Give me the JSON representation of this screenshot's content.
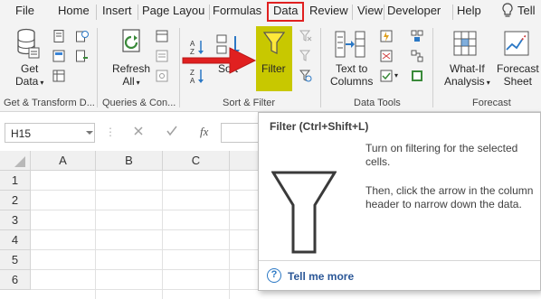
{
  "tabs": [
    "File",
    "Home",
    "Insert",
    "Page Layou",
    "Formulas",
    "Data",
    "Review",
    "View",
    "Developer",
    "Help",
    "Tell"
  ],
  "active_tab": "Data",
  "ribbon": {
    "get_data": {
      "line1": "Get",
      "line2": "Data"
    },
    "refresh_all": {
      "line1": "Refresh",
      "line2": "All"
    },
    "sort": "Sort",
    "filter": "Filter",
    "text_to_columns": {
      "line1": "Text to",
      "line2": "Columns"
    },
    "what_if": {
      "line1": "What-If",
      "line2": "Analysis"
    },
    "forecast_sheet": {
      "line1": "Forecast",
      "line2": "Sheet"
    },
    "groups": {
      "get_transform": "Get & Transform D...",
      "queries": "Queries & Con...",
      "sort_filter": "Sort & Filter",
      "data_tools": "Data Tools",
      "forecast": "Forecast"
    }
  },
  "formula_bar": {
    "name_box": "H15",
    "fx": "fx"
  },
  "grid": {
    "columns": [
      "A",
      "B",
      "C"
    ],
    "rows": [
      "1",
      "2",
      "3",
      "4",
      "5",
      "6"
    ]
  },
  "tooltip": {
    "title": "Filter (Ctrl+Shift+L)",
    "para1": "Turn on filtering for the selected cells.",
    "para2": "Then, click the arrow in the column header to narrow down the data.",
    "help_link": "Tell me more"
  },
  "colors": {
    "highlight_box": "#e02020",
    "filter_button_bg": "#c8c800",
    "arrow": "#e02020",
    "link": "#2b5797"
  }
}
